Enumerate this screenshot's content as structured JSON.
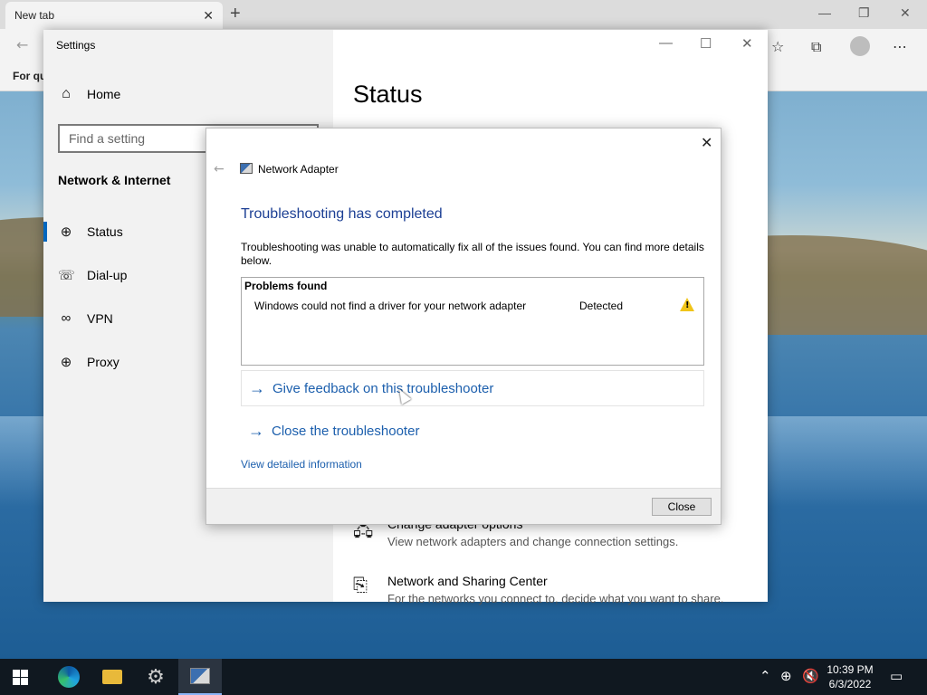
{
  "browser": {
    "tab_title": "New tab",
    "tab_close": "✕",
    "new_tab": "+",
    "favorites_text": "For qu",
    "min": "—",
    "restore": "❐",
    "close": "✕",
    "toolbar_icons": [
      "favorites-icon",
      "collections-icon",
      "profile-icon",
      "more-icon"
    ]
  },
  "settings": {
    "title": "Settings",
    "min": "—",
    "max": "☐",
    "close": "✕",
    "home_label": "Home",
    "search_placeholder": "Find a setting",
    "section_title": "Network & Internet",
    "nav_items": [
      {
        "label": "Status",
        "icon": "globe-icon"
      },
      {
        "label": "Dial-up",
        "icon": "dialup-icon"
      },
      {
        "label": "VPN",
        "icon": "vpn-icon"
      },
      {
        "label": "Proxy",
        "icon": "globe-icon"
      }
    ],
    "page_title": "Status",
    "related": [
      {
        "title": "Change adapter options",
        "subtitle": "View network adapters and change connection settings."
      },
      {
        "title": "Network and Sharing Center",
        "subtitle": "For the networks you connect to, decide what you want to share."
      }
    ]
  },
  "dialog": {
    "close": "✕",
    "back": "←",
    "title": "Network Adapter",
    "heading": "Troubleshooting has completed",
    "description": "Troubleshooting was unable to automatically fix all of the issues found. You can find more details below.",
    "problems_header": "Problems found",
    "problems": [
      {
        "description": "Windows could not find a driver for your network adapter",
        "status": "Detected",
        "icon": "warning-icon"
      }
    ],
    "actions": [
      {
        "label": "Give feedback on this troubleshooter",
        "icon": "arrow-right-icon"
      },
      {
        "label": "Close the troubleshooter",
        "icon": "arrow-right-icon"
      }
    ],
    "detail_link": "View detailed information",
    "close_button": "Close"
  },
  "taskbar": {
    "apps": [
      "edge",
      "file-explorer",
      "settings",
      "network-troubleshooter"
    ],
    "time": "10:39 PM",
    "date": "6/3/2022",
    "tray_icons": [
      "chevron-up-icon",
      "network-globe-icon",
      "volume-muted-icon",
      "notifications-icon"
    ]
  }
}
